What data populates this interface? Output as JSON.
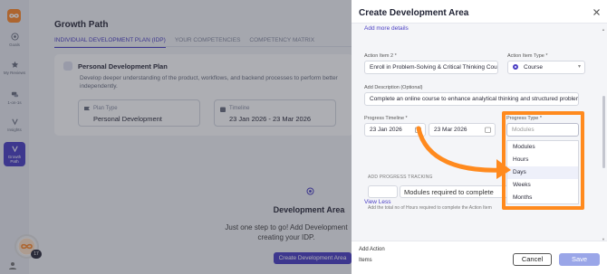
{
  "rail": {
    "items": [
      {
        "label": "Goals",
        "icon": "target-icon"
      },
      {
        "label": "My Reviews",
        "icon": "star-icon"
      },
      {
        "label": "1-on-1s",
        "icon": "chat-icon"
      },
      {
        "label": "Insights",
        "icon": "bulb-icon"
      },
      {
        "label": "Growth Path",
        "icon": "growth-icon"
      }
    ],
    "badge": "17"
  },
  "main": {
    "title": "Growth Path",
    "tabs": [
      "INDIVIDUAL DEVELOPMENT PLAN (IDP)",
      "YOUR COMPETENCIES",
      "COMPETENCY MATRIX"
    ],
    "plan": {
      "title": "Personal Development Plan",
      "description": "Develop deeper understanding of the product, workflows, and backend processes to perform better independently.",
      "plan_type_label": "Plan Type",
      "plan_type_value": "Personal Development",
      "timeline_label": "Timeline",
      "timeline_value": "23 Jan 2026 - 23 Mar 2026"
    },
    "empty": {
      "title": "Development Area",
      "description": "Just one step to go! Add Development creating your IDP.",
      "button": "Create Development Area"
    }
  },
  "drawer": {
    "title": "Create Development Area",
    "add_more_details": "Add more details",
    "action_item_label": "Action Item 2 *",
    "action_item_value": "Enroll in Problem-Solving & Critical Thinking Course",
    "action_item_type_label": "Action Item Type *",
    "action_item_type_value": "Course",
    "add_description_label": "Add Description (Optional)",
    "add_description_value": "Complete an online course to enhance analytical thinking and structured problem",
    "progress_timeline_label": "Progress Timeline *",
    "start_date": "23 Jan 2026",
    "end_date": "23 Mar 2026",
    "progress_type_label": "Progress Type *",
    "progress_type_placeholder": "Modules",
    "progress_type_options": [
      "Modules",
      "Hours",
      "Days",
      "Weeks",
      "Months"
    ],
    "tracking_label": "ADD PROGRESS TRACKING",
    "tracking_input": "Modules required to complete",
    "tracking_hint": "Add the total no of Hours required to complete the Action Item",
    "view_less": "View Less",
    "add_action_items": "Add Action Items",
    "cancel": "Cancel",
    "save": "Save"
  },
  "colors": {
    "accent": "#4b3fc4",
    "highlight": "#ff8a1e",
    "save_disabled": "#9aa6e8"
  }
}
